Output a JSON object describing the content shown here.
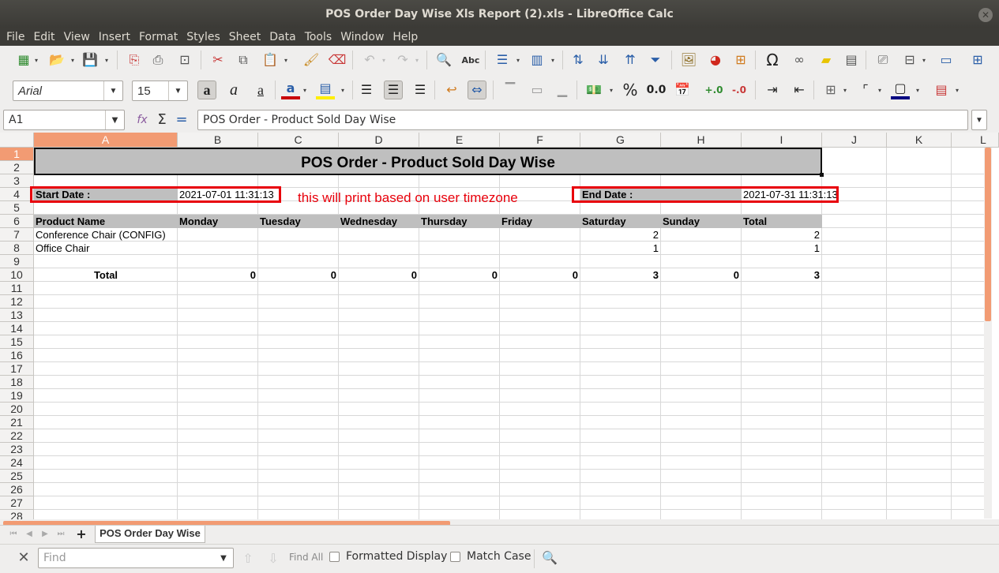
{
  "window": {
    "title": "POS Order Day Wise Xls Report (2).xls - LibreOffice Calc"
  },
  "menu": [
    "File",
    "Edit",
    "View",
    "Insert",
    "Format",
    "Styles",
    "Sheet",
    "Data",
    "Tools",
    "Window",
    "Help"
  ],
  "format": {
    "font_name": "Arial",
    "font_size": "15"
  },
  "formula_bar": {
    "cell_ref": "A1",
    "content": "POS Order - Product Sold Day Wise"
  },
  "columns": [
    "A",
    "B",
    "C",
    "D",
    "E",
    "F",
    "G",
    "H",
    "I",
    "J",
    "K",
    "L"
  ],
  "rows": [
    "1",
    "2",
    "3",
    "4",
    "5",
    "6",
    "7",
    "8",
    "9",
    "10",
    "11",
    "12",
    "13",
    "14",
    "15",
    "16",
    "17",
    "18",
    "19",
    "20",
    "21",
    "22",
    "23",
    "24",
    "25",
    "26",
    "27",
    "28"
  ],
  "sheet": {
    "title": "POS Order - Product Sold Day Wise",
    "start_label": "Start Date :",
    "start_value": "2021-07-01 11:31:13",
    "end_label": "End Date :",
    "end_value": "2021-07-31 11:31:13",
    "annotation": "this will print based on user timezone",
    "headers": [
      "Product Name",
      "Monday",
      "Tuesday",
      "Wednesday",
      "Thursday",
      "Friday",
      "Saturday",
      "Sunday",
      "Total"
    ],
    "rows": [
      {
        "product": "Conference Chair (CONFIG)",
        "values": [
          "",
          "",
          "",
          "",
          "",
          "2",
          "",
          "2"
        ]
      },
      {
        "product": "Office Chair",
        "values": [
          "",
          "",
          "",
          "",
          "",
          "1",
          "",
          "1"
        ]
      }
    ],
    "total_label": "Total",
    "totals": [
      "0",
      "0",
      "0",
      "0",
      "0",
      "3",
      "0",
      "3"
    ]
  },
  "sheet_tab": "POS Order Day Wise",
  "findbar": {
    "placeholder": "Find",
    "find_all": "Find All",
    "formatted_display": "Formatted Display",
    "match_case": "Match Case"
  },
  "colors": {
    "accent": "#f29b73",
    "annotation": "#e8000b",
    "header_fill": "#bfbfbf"
  }
}
